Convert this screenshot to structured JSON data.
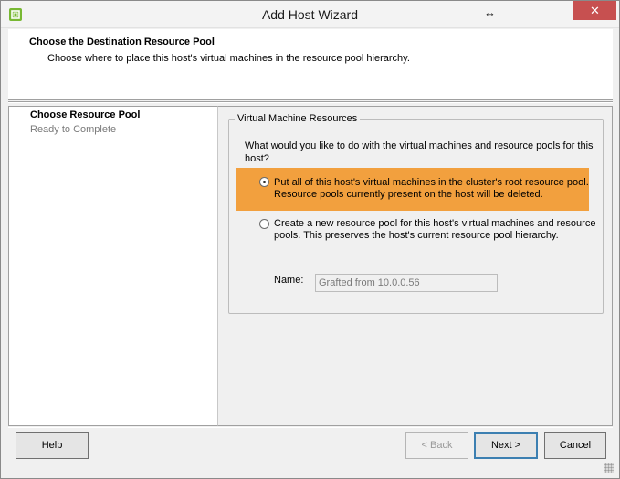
{
  "window": {
    "title": "Add Host Wizard",
    "icons": {
      "app": "vsphere-logo-icon",
      "resize": "resize-arrows-icon",
      "close": "close-icon"
    },
    "close_glyph": "✕",
    "resize_glyph": "↔"
  },
  "header": {
    "title": "Choose the Destination Resource Pool",
    "subtitle": "Choose where to place this host's virtual machines in the resource pool hierarchy."
  },
  "steps": [
    {
      "label": "Choose Resource Pool",
      "active": true
    },
    {
      "label": "Ready to Complete",
      "active": false
    }
  ],
  "resources": {
    "group_label": "Virtual Machine Resources",
    "question": "What would you like to do with the virtual machines and resource pools for this host?",
    "options": [
      {
        "label": "Put all of this host's virtual machines in the cluster's root resource pool. Resource pools currently present on the host will be deleted.",
        "selected": true
      },
      {
        "label": "Create a new resource pool for this host's virtual machines and resource pools.  This preserves the host's current resource pool hierarchy.",
        "selected": false
      }
    ],
    "name_label": "Name:",
    "name_value": "Grafted from 10.0.0.56"
  },
  "buttons": {
    "help": "Help",
    "back": "< Back",
    "next": "Next >",
    "cancel": "Cancel"
  },
  "colors": {
    "selection": "#f2a03e",
    "close_button": "#c75050",
    "default_button_border": "#3c7fb1"
  }
}
